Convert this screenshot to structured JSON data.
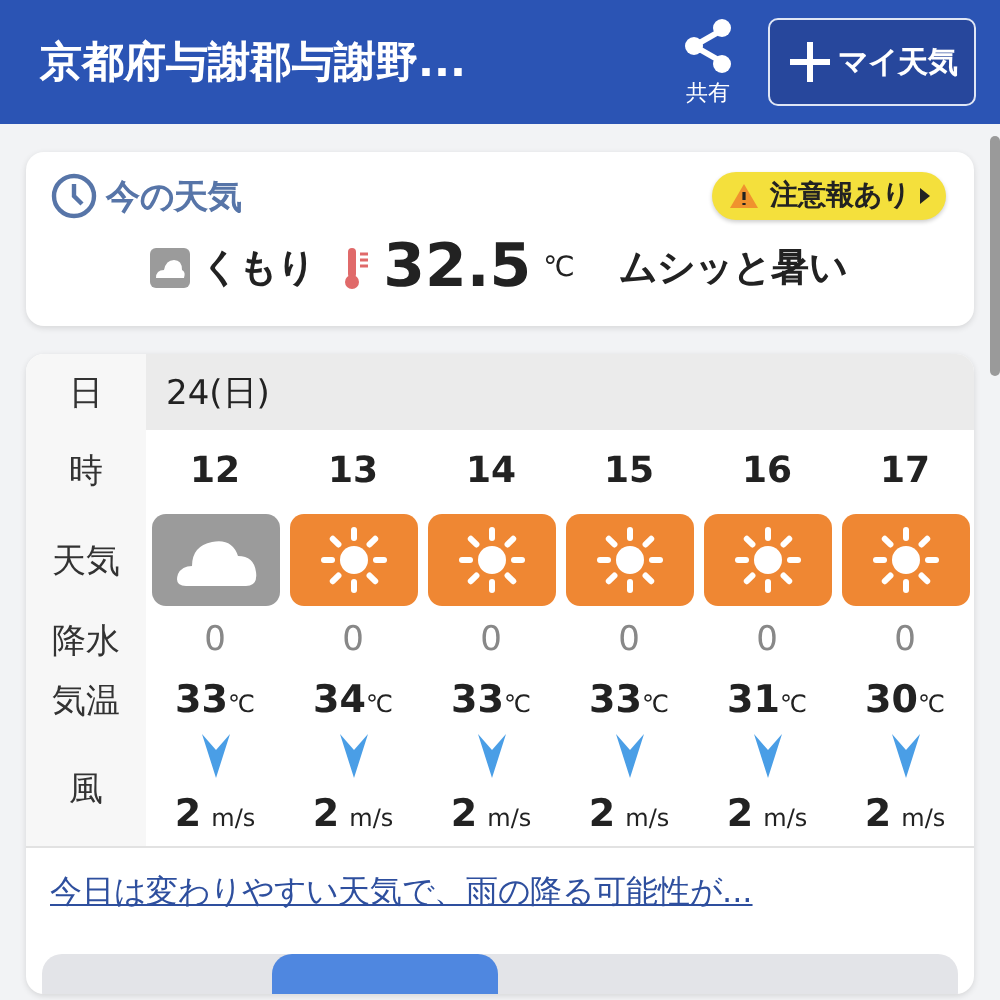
{
  "header": {
    "title": "京都府与謝郡与謝野...",
    "share_label": "共有",
    "my_weather_button": "マイ天気"
  },
  "current": {
    "heading": "今の天気",
    "alert": "注意報あり",
    "condition": "くもり",
    "temperature": "32.5",
    "temp_unit": "℃",
    "feel": "ムシッと暑い"
  },
  "forecast": {
    "row_labels": [
      "日",
      "時",
      "天気",
      "降水",
      "気温",
      "風"
    ],
    "date": "24(日)",
    "hours": [
      {
        "hour": "12",
        "kind": "cloudy",
        "precip": "0",
        "temp": "33",
        "temp_unit": "℃",
        "wind": "2",
        "wind_unit": "m/s"
      },
      {
        "hour": "13",
        "kind": "sunny",
        "precip": "0",
        "temp": "34",
        "temp_unit": "℃",
        "wind": "2",
        "wind_unit": "m/s"
      },
      {
        "hour": "14",
        "kind": "sunny",
        "precip": "0",
        "temp": "33",
        "temp_unit": "℃",
        "wind": "2",
        "wind_unit": "m/s"
      },
      {
        "hour": "15",
        "kind": "sunny",
        "precip": "0",
        "temp": "33",
        "temp_unit": "℃",
        "wind": "2",
        "wind_unit": "m/s"
      },
      {
        "hour": "16",
        "kind": "sunny",
        "precip": "0",
        "temp": "31",
        "temp_unit": "℃",
        "wind": "2",
        "wind_unit": "m/s"
      },
      {
        "hour": "17",
        "kind": "sunny",
        "precip": "0",
        "temp": "30",
        "temp_unit": "℃",
        "wind": "2",
        "wind_unit": "m/s"
      }
    ],
    "summary_link": "今日は変わりやすい天気で、雨の降る可能性が..."
  }
}
